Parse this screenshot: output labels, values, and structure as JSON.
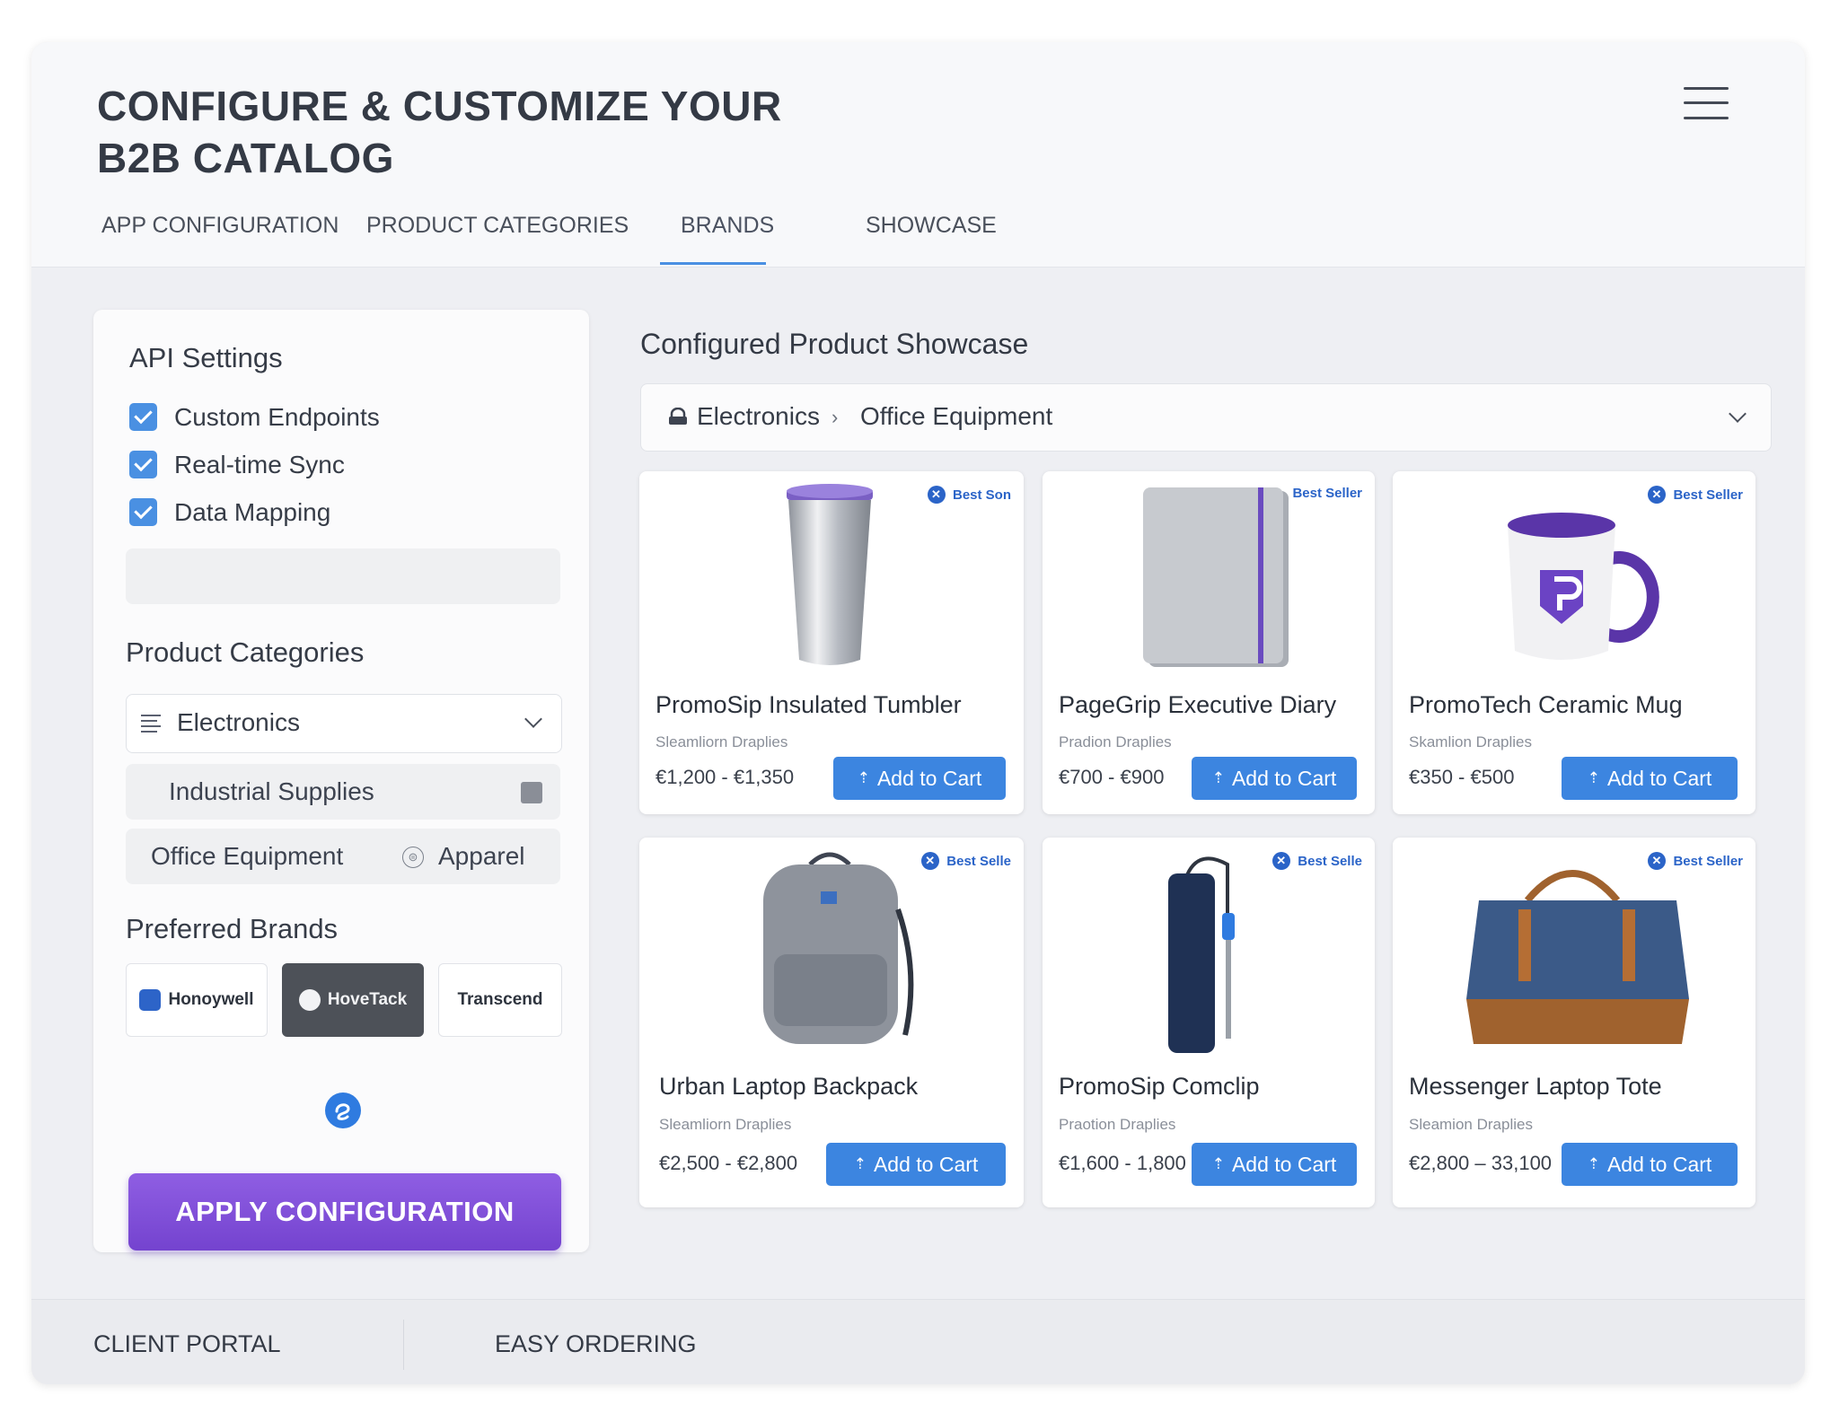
{
  "header": {
    "title_line1": "CONFIGURE & CUSTOMIZE YOUR",
    "title_line2": "B2B CATALOG",
    "menu_icon": "hamburger-menu-icon",
    "tabs": [
      {
        "label": "APP CONFIGURATION"
      },
      {
        "label": "PRODUCT CATEGORIES"
      },
      {
        "label": "BRANDS",
        "active": true
      },
      {
        "label": "SHOWCASE"
      }
    ]
  },
  "sidebar": {
    "api_title": "API Settings",
    "api_options": [
      {
        "label": "Custom Endpoints",
        "checked": true
      },
      {
        "label": "Real-time Sync",
        "checked": true
      },
      {
        "label": "Data Mapping",
        "checked": true
      }
    ],
    "categories_title": "Product Categories",
    "category_select": "Electronics",
    "category_rows": {
      "industrial": "Industrial Supplies",
      "office": "Office Equipment",
      "apparel": "Apparel"
    },
    "brands_title": "Preferred Brands",
    "brands": [
      "Honoywell",
      "HoveTack",
      "Transcend"
    ],
    "apply_label": "APPLY CONFIGURATION"
  },
  "showcase": {
    "title": "Configured Product Showcase",
    "breadcrumb": [
      "Electronics",
      "Office Equipment"
    ],
    "products": [
      {
        "name": "PromoSip Insulated Tumbler",
        "sub": "Sleamliorn Draplies",
        "price": "€1,200 - €1,350",
        "badge": "Best Son",
        "cta": "Add to Cart"
      },
      {
        "name": "PageGrip Executive Diary",
        "sub": "Pradion Draplies",
        "price": "€700 - €900",
        "badge": "Best Seller",
        "cta": "Add to Cart"
      },
      {
        "name": "PromoTech Ceramic Mug",
        "sub": "Skamlion Draplies",
        "price": "€350 - €500",
        "badge": "Best Seller",
        "cta": "Add to Cart"
      },
      {
        "name": "Urban Laptop Backpack",
        "sub": "Sleamliorn Draplies",
        "price": "€2,500 - €2,800",
        "badge": "Best Selle",
        "cta": "Add to Cart"
      },
      {
        "name": "PromoSip Comclip",
        "sub": "Praotion Draplies",
        "price": "€1,600 - 1,800",
        "badge": "Best Selle",
        "cta": "Add to Cart"
      },
      {
        "name": "Messenger Laptop Tote",
        "sub": "Sleamion Draplies",
        "price": "€2,800 – 33,100",
        "badge": "Best Seller",
        "cta": "Add to Cart"
      }
    ]
  },
  "footer": {
    "items": [
      "CLIENT PORTAL",
      "EASY ORDERING"
    ]
  },
  "colors": {
    "accent": "#4a90e2",
    "cart_button": "#3c85e0",
    "apply_button": "#7c4ddb"
  }
}
